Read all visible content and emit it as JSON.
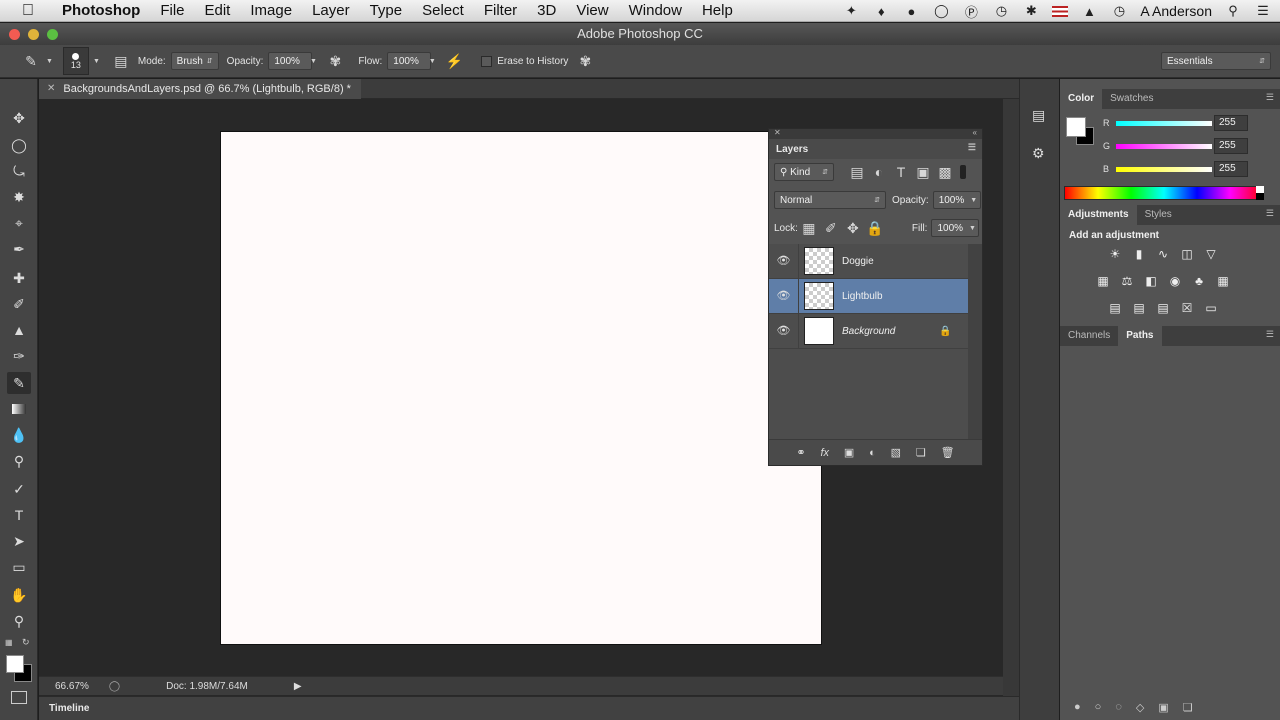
{
  "menubar": {
    "app_name": "Photoshop",
    "items": [
      "File",
      "Edit",
      "Image",
      "Layer",
      "Type",
      "Select",
      "Filter",
      "3D",
      "View",
      "Window",
      "Help"
    ],
    "user": "A Anderson"
  },
  "window": {
    "title": "Adobe Photoshop CC"
  },
  "options_bar": {
    "brush_size": "13",
    "mode_label": "Mode:",
    "mode_value": "Brush",
    "opacity_label": "Opacity:",
    "opacity_value": "100%",
    "flow_label": "Flow:",
    "flow_value": "100%",
    "erase_history_label": "Erase to History",
    "workspace": "Essentials"
  },
  "document": {
    "tab_title": "BackgroundsAndLayers.psd @ 66.7% (Lightbulb, RGB/8) *",
    "zoom": "66.67%",
    "doc_info": "Doc: 1.98M/7.64M",
    "canvas_color": "#fffafa"
  },
  "timeline": {
    "label": "Timeline"
  },
  "layers_panel": {
    "title": "Layers",
    "kind_label": "Kind",
    "blend_mode": "Normal",
    "opacity_label": "Opacity:",
    "opacity_value": "100%",
    "lock_label": "Lock:",
    "fill_label": "Fill:",
    "fill_value": "100%",
    "layers": [
      {
        "name": "Doggie",
        "selected": false,
        "locked": false
      },
      {
        "name": "Lightbulb",
        "selected": true,
        "locked": false
      },
      {
        "name": "Background",
        "selected": false,
        "locked": true
      }
    ]
  },
  "color_panel": {
    "tabs": [
      "Color",
      "Swatches"
    ],
    "r_label": "R",
    "r_value": "255",
    "g_label": "G",
    "g_value": "255",
    "b_label": "B",
    "b_value": "255"
  },
  "adjustments_panel": {
    "tabs": [
      "Adjustments",
      "Styles"
    ],
    "heading": "Add an adjustment"
  },
  "paths_panel": {
    "tabs": [
      "Channels",
      "Paths"
    ]
  },
  "colors": {
    "selected_layer": "#5f7ea8",
    "panel_bg": "#535353",
    "canvas": "#fffafa"
  }
}
